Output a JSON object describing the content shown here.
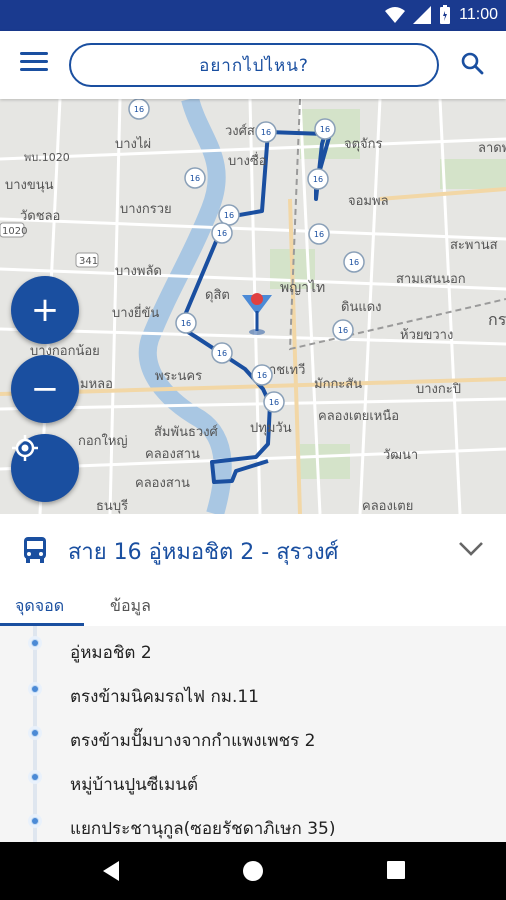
{
  "status_bar": {
    "time": "11:00",
    "icons": [
      "wifi-icon",
      "signal-icon",
      "battery-icon"
    ]
  },
  "app_bar": {
    "search_placeholder": "อยากไปไหน?"
  },
  "map": {
    "labels": [
      {
        "text": "วงศ์สว่าง"
      },
      {
        "text": "จตุจักร"
      },
      {
        "text": "ลาดพ"
      },
      {
        "text": "บางไผ่"
      },
      {
        "text": "บางซื่อ"
      },
      {
        "text": "พบ.1020"
      },
      {
        "text": "บางขนุน"
      },
      {
        "text": "วัดชลอ"
      },
      {
        "text": "จอมพล"
      },
      {
        "text": "บางกรวย"
      },
      {
        "text": "สะพานส"
      },
      {
        "text": "บางพลัด"
      },
      {
        "text": "ดุสิต"
      },
      {
        "text": "พญาไท"
      },
      {
        "text": "สามเสนนอก"
      },
      {
        "text": "บางยี่ขัน"
      },
      {
        "text": "ดินแดง"
      },
      {
        "text": "ห้วยขวาง"
      },
      {
        "text": "บางกอกน้อย"
      },
      {
        "text": "พระนคร"
      },
      {
        "text": "ราชเทวี"
      },
      {
        "text": "บางกะปิ"
      },
      {
        "text": "มหลอ"
      },
      {
        "text": "มักกะสัน"
      },
      {
        "text": "คลองเตยเหนือ"
      },
      {
        "text": "กอกใหญ่"
      },
      {
        "text": "สัมพันธวงศ์"
      },
      {
        "text": "ปทุมวัน"
      },
      {
        "text": "คลองสาน"
      },
      {
        "text": "วัฒนา"
      },
      {
        "text": "คลองสาน"
      },
      {
        "text": "ธนบุรี"
      },
      {
        "text": "คลองเตย"
      },
      {
        "text": "กร"
      },
      {
        "text": "1020"
      },
      {
        "text": "341"
      }
    ],
    "bus_stop_badge": "16",
    "controls": {
      "zoom_in": "+",
      "zoom_out": "−"
    }
  },
  "route": {
    "title": "สาย 16 อู่หมอชิต 2 - สุรวงศ์"
  },
  "tabs": [
    {
      "label": "จุดจอด",
      "active": true
    },
    {
      "label": "ข้อมูล",
      "active": false
    }
  ],
  "stops": [
    "อู่หมอชิต 2",
    "ตรงข้ามนิคมรถไฟ กม.11",
    "ตรงข้ามปั๊มบางจากกำแพงเพชร 2",
    "หมู่บ้านปูนซีเมนต์",
    "แยกประชานุกูล(ซอยรัชดาภิเษก 35)"
  ],
  "colors": {
    "primary": "#1a4fa0",
    "status_bar": "#1a3a8f",
    "route_line": "#1a4fa0"
  }
}
